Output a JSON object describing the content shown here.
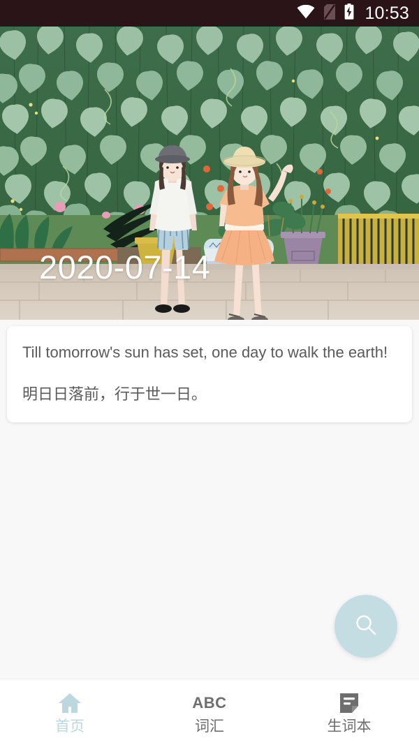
{
  "status_bar": {
    "time": "10:53",
    "icons": [
      "wifi-icon",
      "no-sim-icon",
      "battery-charging-icon"
    ],
    "background_color": "#2b1417"
  },
  "hero": {
    "date": "2020-07-14",
    "illustration_alt": "two-girls-under-heart-leaf-vine-wall",
    "scene": {
      "leaf_wall_color": "#8fb89a",
      "background_green": "#3c6b49",
      "pavement_color": "#d8cec2",
      "girl_left": {
        "hat_color": "#6b6b72",
        "top_color": "#f2f2f0",
        "shorts_color": "#a9c7d8",
        "shoes_color": "#1d1d1d"
      },
      "girl_right": {
        "hat_color": "#e8d9ae",
        "hair_color": "#8a5a3c",
        "outfit_color": "#f5b183"
      },
      "pots": [
        "blue-white-porcelain-pot",
        "purple-pot",
        "terracotta-pot"
      ],
      "fence_color": "#c9b03f"
    }
  },
  "quote_card": {
    "english": "Till tomorrow's sun has set, one day to walk the earth!",
    "chinese": "明日日落前，行于世一日。"
  },
  "fab": {
    "icon": "search-icon",
    "background_color": "#c3dde3",
    "icon_color": "#ffffff"
  },
  "bottom_nav": {
    "active_color": "#bcd8de",
    "inactive_color": "#6e6e6e",
    "items": [
      {
        "label": "首页",
        "icon": "home-icon",
        "active": true
      },
      {
        "label": "词汇",
        "icon": "abc-icon",
        "active": false
      },
      {
        "label": "生词本",
        "icon": "note-icon",
        "active": false
      }
    ]
  }
}
